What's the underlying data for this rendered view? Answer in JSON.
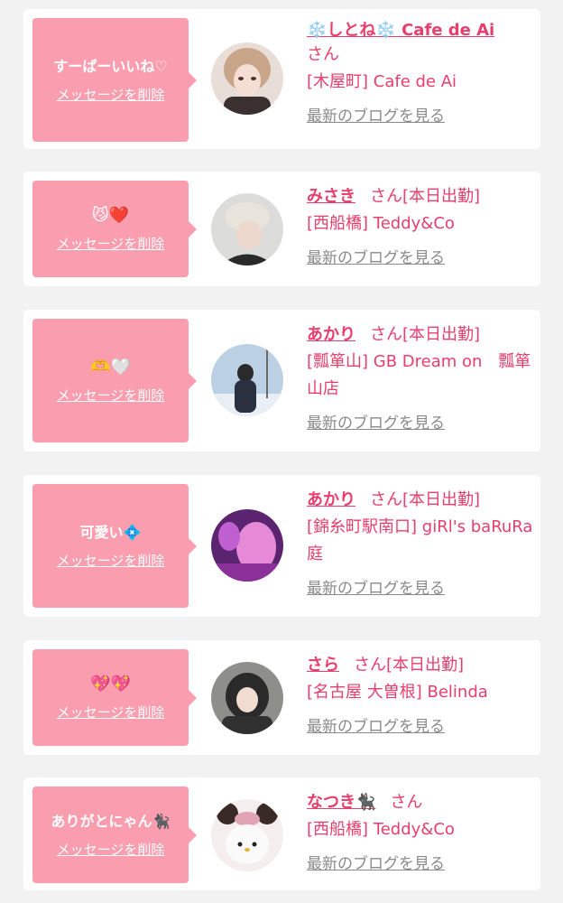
{
  "delete_label": "メッセージを削除",
  "blog_label": "最新のブログを見る",
  "cards": [
    {
      "message": "すーぱーいいね♡",
      "name": "❄️しとね❄️ Cafe de Ai",
      "san": "さん",
      "status": "",
      "shop": "[木屋町] Cafe de Ai"
    },
    {
      "message": "😼❤️",
      "name": "みさき",
      "san": "さん",
      "status": "[本日出勤]",
      "shop": "[西船橋] Teddy&Co"
    },
    {
      "message": "🫶🤍",
      "name": "あかり",
      "san": "さん",
      "status": "[本日出勤]",
      "shop": "[瓢箪山] GB Dream on　瓢箪山店"
    },
    {
      "message": "可愛い💠",
      "name": "あかり",
      "san": "さん",
      "status": "[本日出勤]",
      "shop": "[錦糸町駅南口] giRl's baRuRa庭"
    },
    {
      "message": "💖💖",
      "name": "さら",
      "san": "さん",
      "status": "[本日出勤]",
      "shop": "[名古屋 大曽根] Belinda"
    },
    {
      "message": "ありがとにゃん🐈‍⬛",
      "name": "なつき🐈‍⬛",
      "san": "さん",
      "status": "",
      "shop": "[西船橋] Teddy&Co"
    }
  ],
  "colors": {
    "accent": "#e83e6c",
    "bubble": "#fa9dae",
    "background": "#f2f2f2",
    "blog_link": "#8a8a8a"
  }
}
